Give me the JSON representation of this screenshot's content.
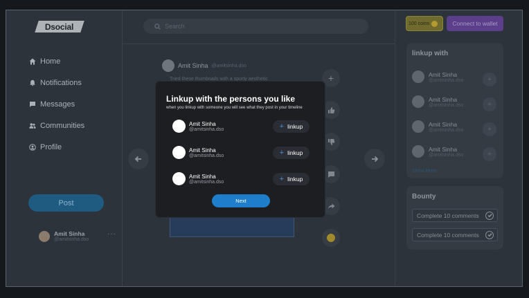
{
  "brand": {
    "logo_text": "Dsocial"
  },
  "nav": {
    "items": [
      {
        "label": "Home",
        "icon": "home-icon"
      },
      {
        "label": "Notifications",
        "icon": "bell-icon"
      },
      {
        "label": "Messages",
        "icon": "message-icon"
      },
      {
        "label": "Communities",
        "icon": "users-icon"
      },
      {
        "label": "Profile",
        "icon": "profile-icon"
      }
    ],
    "post_label": "Post"
  },
  "current_user": {
    "name": "Amit Sinha",
    "handle": "@amitsinha.dso",
    "more": "···"
  },
  "search": {
    "placeholder": "Search",
    "value": ""
  },
  "feed": {
    "author_name": "Amit Sinha",
    "author_handle": "@amitsinha.dso",
    "text": "Tried these thumbnails with a sporty aesthetic"
  },
  "wallet": {
    "coins_label": "100 coins",
    "connect_label": "Connect to wallet"
  },
  "linkup_panel": {
    "title": "linkup with",
    "users": [
      {
        "name": "Amit Sinha",
        "handle": "@amitsinha.dso"
      },
      {
        "name": "Amit Sinha",
        "handle": "@amitsinha.dso"
      },
      {
        "name": "Amit Sinha",
        "handle": "@amitsinha.dso"
      },
      {
        "name": "Amit Sinha",
        "handle": "@amitsinha.dso"
      }
    ],
    "show_more": "Show More"
  },
  "bounty": {
    "title": "Bounty",
    "items": [
      {
        "label": "Complete 10 comments"
      },
      {
        "label": "Complete 10 comments"
      }
    ]
  },
  "modal": {
    "title": "Linkup with the persons you like",
    "subtitle": "when you linkup with someone you will see what they post in your timeline",
    "users": [
      {
        "name": "Amit Sinha",
        "handle": "@amitsinha.dso",
        "button": "linkup"
      },
      {
        "name": "Amit Sinha",
        "handle": "@amitsinha.dso",
        "button": "linkup"
      },
      {
        "name": "Amit Sinha",
        "handle": "@amitsinha.dso",
        "button": "linkup"
      }
    ],
    "next_label": "Next"
  },
  "colors": {
    "background": "#2c333b",
    "modal": "#1c1e22",
    "accent_blue": "#1f7ecb",
    "wallet_purple": "#5b3f8a",
    "coins_gold": "#6f6a2e"
  }
}
